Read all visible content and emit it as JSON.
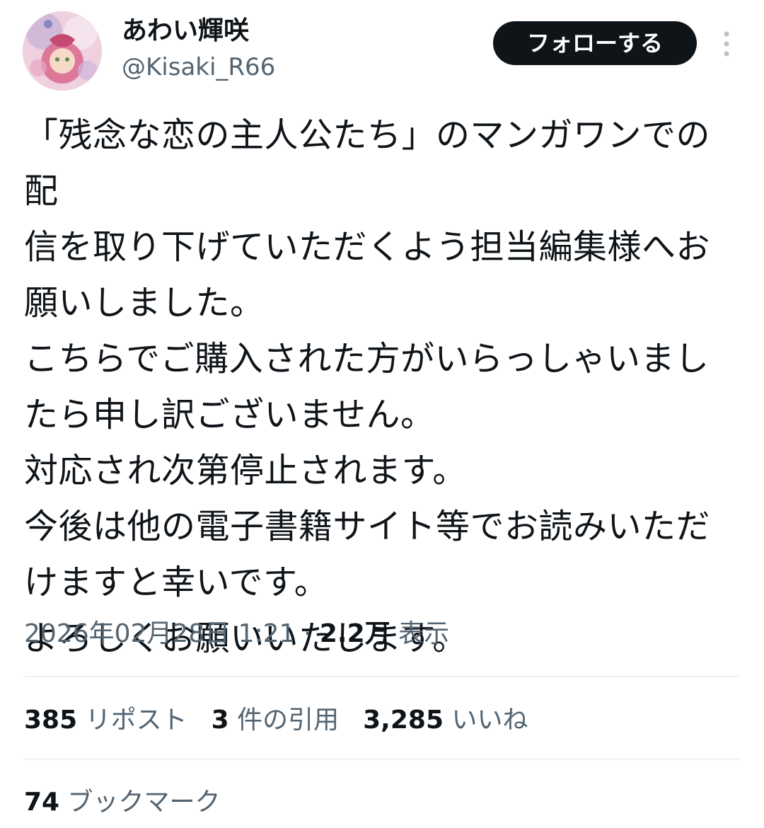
{
  "author": {
    "display_name": "あわい輝咲",
    "handle": "@Kisaki_R66",
    "avatar_icon": "avatar-illustration"
  },
  "follow_button": {
    "label": "フォローする"
  },
  "more_icon": "more-vertical-icon",
  "tweet": {
    "text": "「残念な恋の主人公たち」のマンガワンでの配\n信を取り下げていただくよう担当編集様へお\n願いしました。\nこちらでご購入された方がいらっしゃいまし\nたら申し訳ございません。\n対応され次第停止されます。\n今後は他の電子書籍サイト等でお読みいただ\nけますと幸いです。\nよろしくお願いいたします。",
    "timestamp": "2026年02月28日 1:21",
    "separator": " · ",
    "views_count": "2.2万",
    "views_label": " 表示"
  },
  "stats": {
    "reposts": {
      "count": "385",
      "label": " リポスト"
    },
    "quotes": {
      "count": "3",
      "label": " 件の引用"
    },
    "likes": {
      "count": "3,285",
      "label": " いいね"
    },
    "bookmarks": {
      "count": "74",
      "label": " ブックマーク"
    }
  },
  "colors": {
    "primary_text": "#0f1419",
    "secondary_text": "#536471",
    "divider": "#eff3f4",
    "button_bg": "#0f1419",
    "button_text": "#ffffff"
  }
}
